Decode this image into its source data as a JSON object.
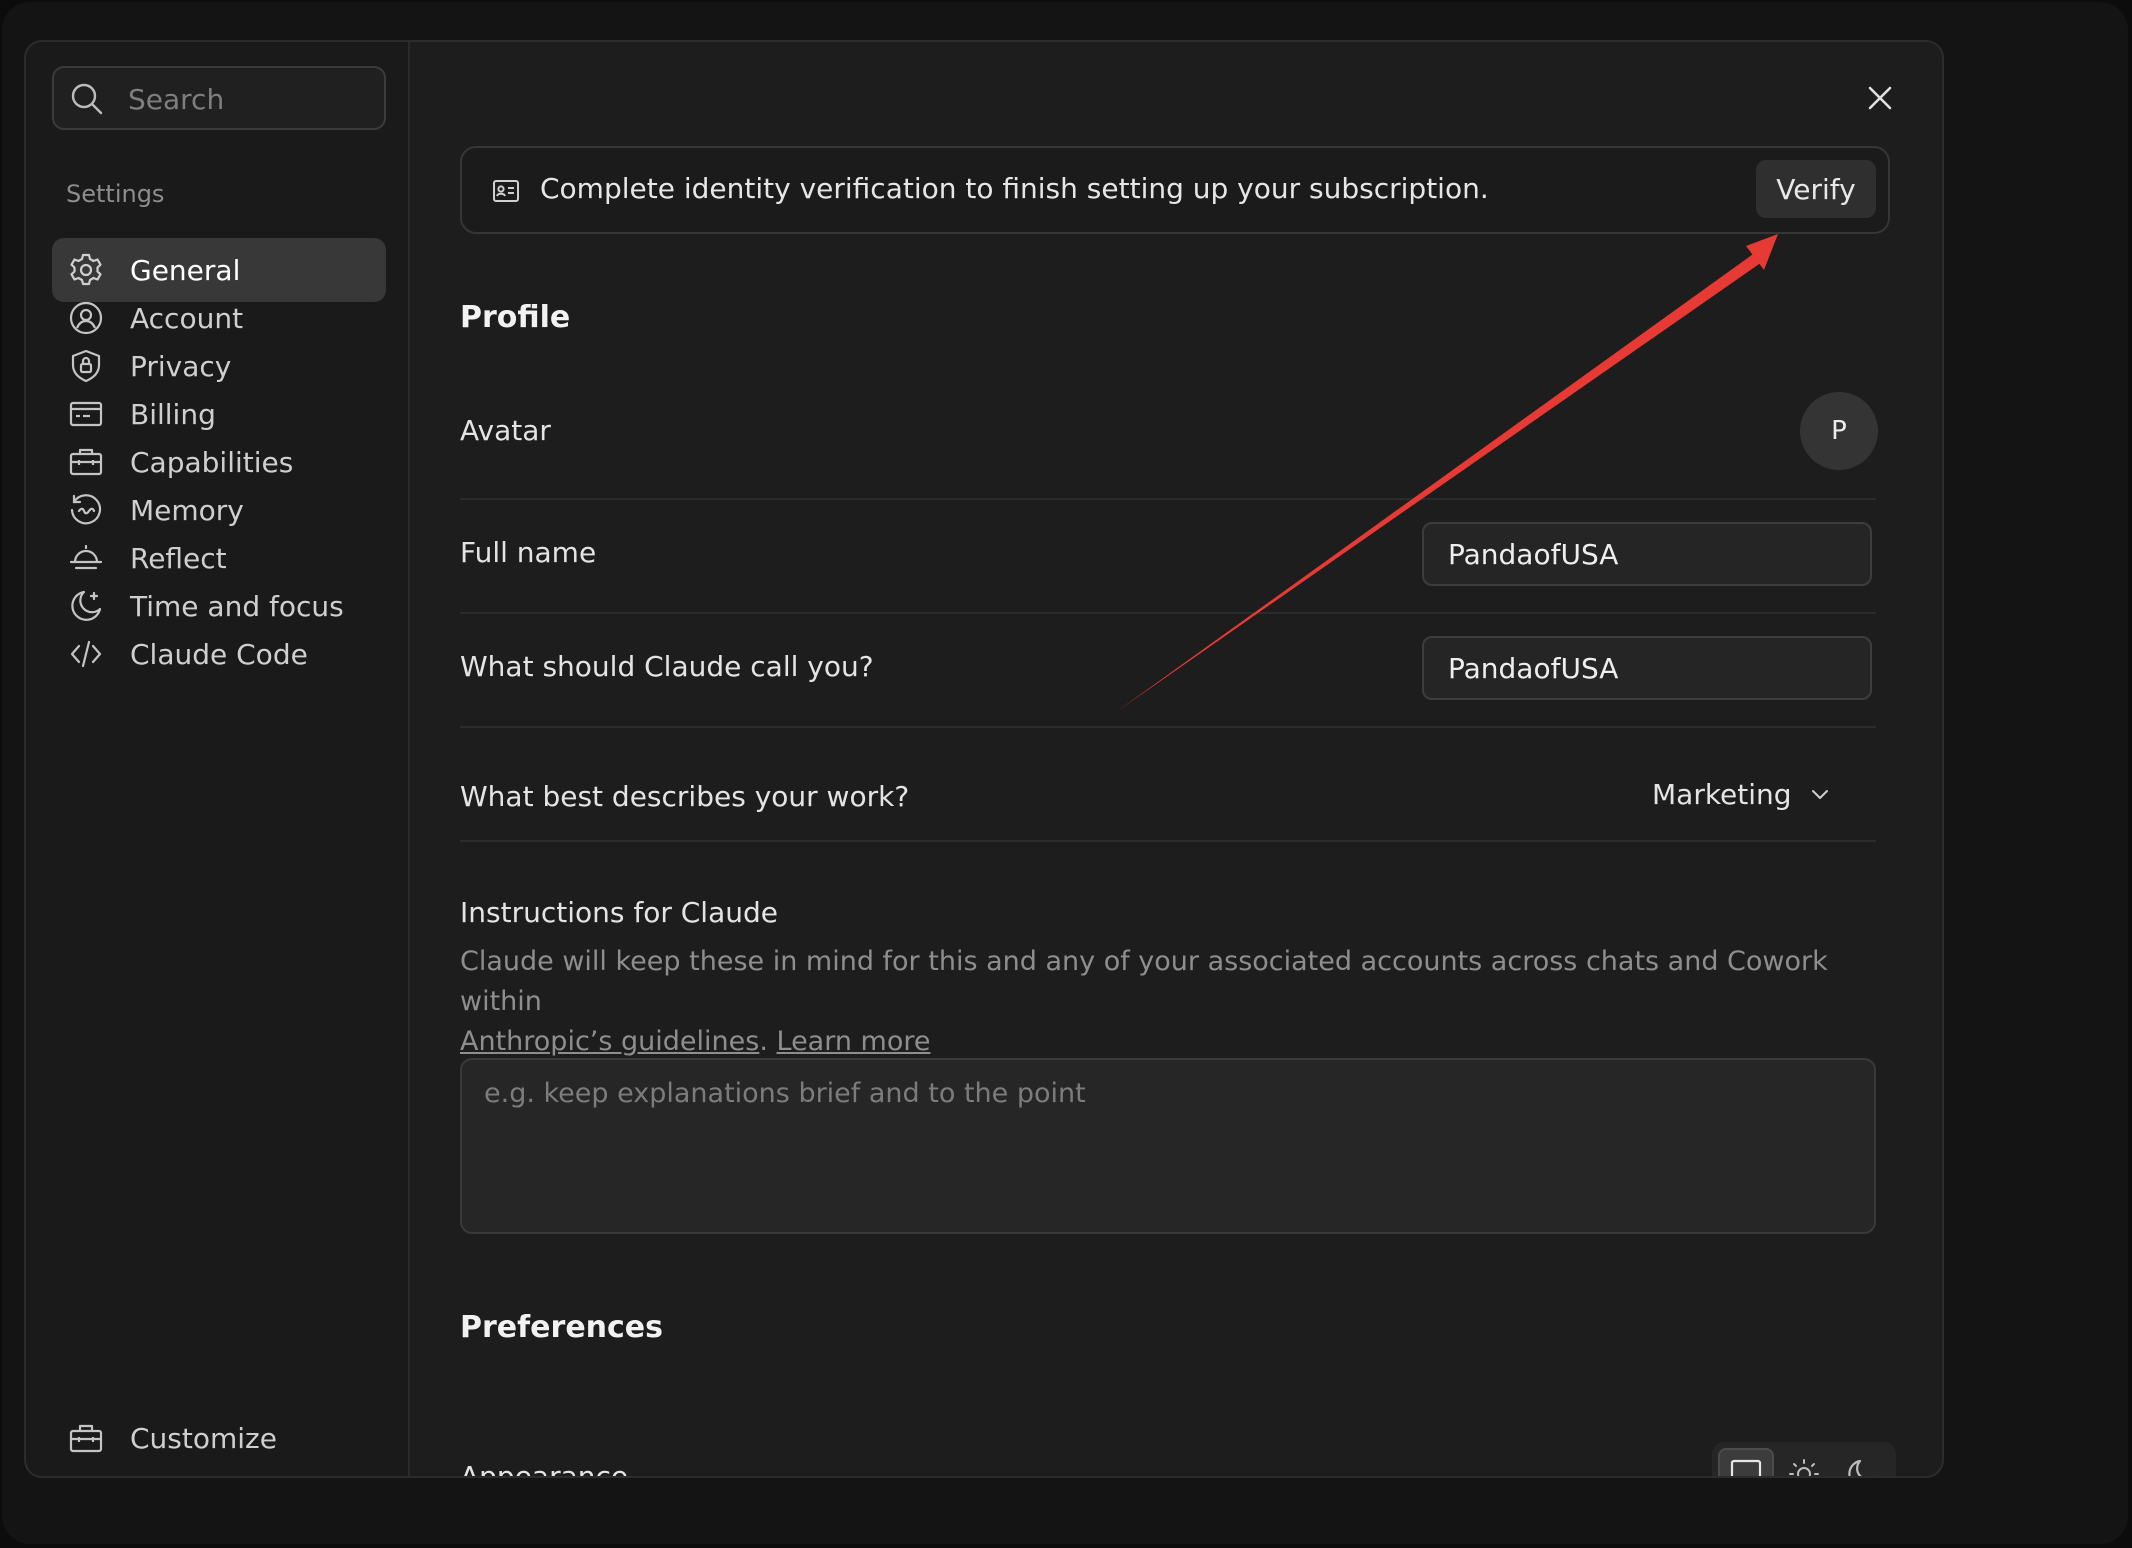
{
  "search": {
    "placeholder": "Search"
  },
  "sidebar": {
    "section_label": "Settings",
    "items": [
      {
        "label": "General",
        "icon": "gear-icon",
        "active": true
      },
      {
        "label": "Account",
        "icon": "user-circle-icon"
      },
      {
        "label": "Privacy",
        "icon": "shield-lock-icon"
      },
      {
        "label": "Billing",
        "icon": "credit-card-icon"
      },
      {
        "label": "Capabilities",
        "icon": "briefcase-icon"
      },
      {
        "label": "Memory",
        "icon": "history-icon"
      },
      {
        "label": "Reflect",
        "icon": "sunrise-icon"
      },
      {
        "label": "Time and focus",
        "icon": "moon-star-icon"
      },
      {
        "label": "Claude Code",
        "icon": "code-icon"
      }
    ],
    "footer_item": {
      "label": "Customize",
      "icon": "toolbox-icon"
    }
  },
  "banner": {
    "icon": "id-card-icon",
    "text": "Complete identity verification to finish setting up your subscription.",
    "button_label": "Verify"
  },
  "profile": {
    "heading": "Profile",
    "avatar_label": "Avatar",
    "avatar_initial": "P",
    "full_name_label": "Full name",
    "full_name_value": "PandaofUSA",
    "call_you_label": "What should Claude call you?",
    "call_you_value": "PandaofUSA",
    "work_label": "What best describes your work?",
    "work_value": "Marketing",
    "instructions_label": "Instructions for Claude",
    "instructions_desc": "Claude will keep these in mind for this and any of your associated accounts across chats and Cowork within",
    "guidelines_link": "Anthropic’s guidelines",
    "learn_more_link": "Learn more",
    "instructions_placeholder": "e.g. keep explanations brief and to the point"
  },
  "preferences": {
    "heading": "Preferences",
    "appearance_label": "Appearance",
    "appearance_options": [
      {
        "icon": "monitor-icon",
        "active": true
      },
      {
        "icon": "sun-icon"
      },
      {
        "icon": "moon-icon"
      }
    ]
  },
  "annotation": {
    "color": "#e83a35"
  }
}
